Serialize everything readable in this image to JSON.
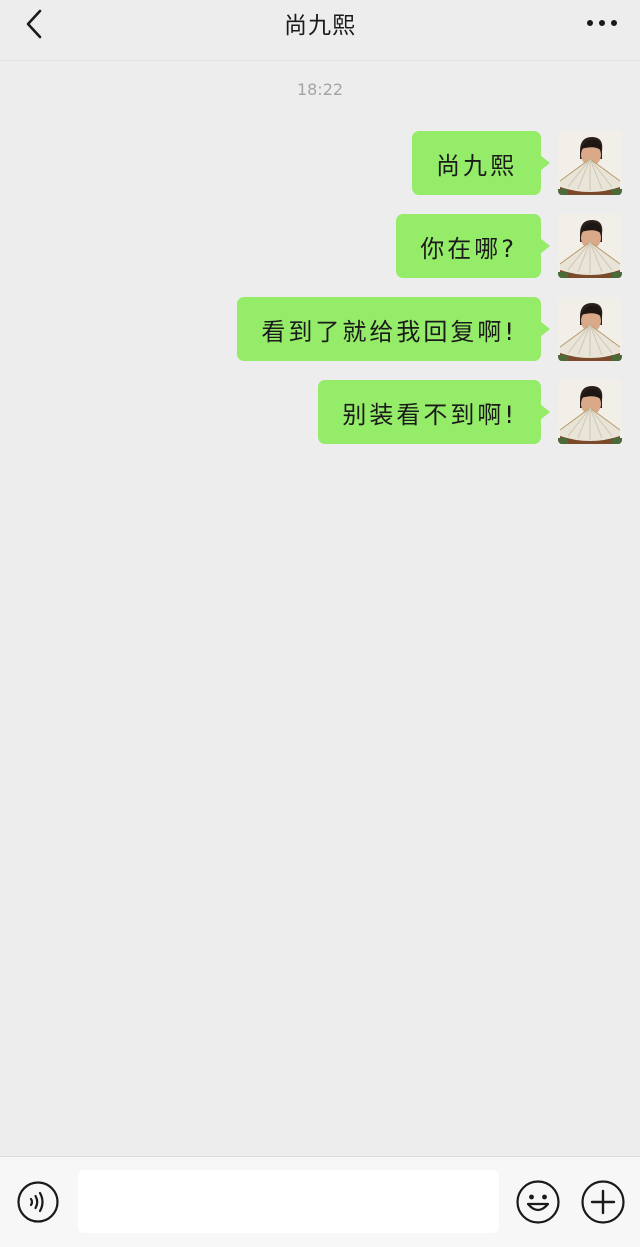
{
  "header": {
    "title": "尚九熙",
    "back_icon": "chevron-left-icon",
    "more_icon": "more-dots-icon"
  },
  "timestamp": "18:22",
  "messages": [
    {
      "text": "尚九熙",
      "sender": "self"
    },
    {
      "text": "你在哪?",
      "sender": "self"
    },
    {
      "text": "看到了就给我回复啊!",
      "sender": "self"
    },
    {
      "text": "别装看不到啊!",
      "sender": "self"
    }
  ],
  "input_bar": {
    "value": "",
    "voice_icon": "voice-icon",
    "emoji_icon": "emoji-icon",
    "plus_icon": "plus-icon"
  },
  "colors": {
    "background": "#ededed",
    "bubble": "#95ec69",
    "timestamp": "#a4a4a4"
  }
}
